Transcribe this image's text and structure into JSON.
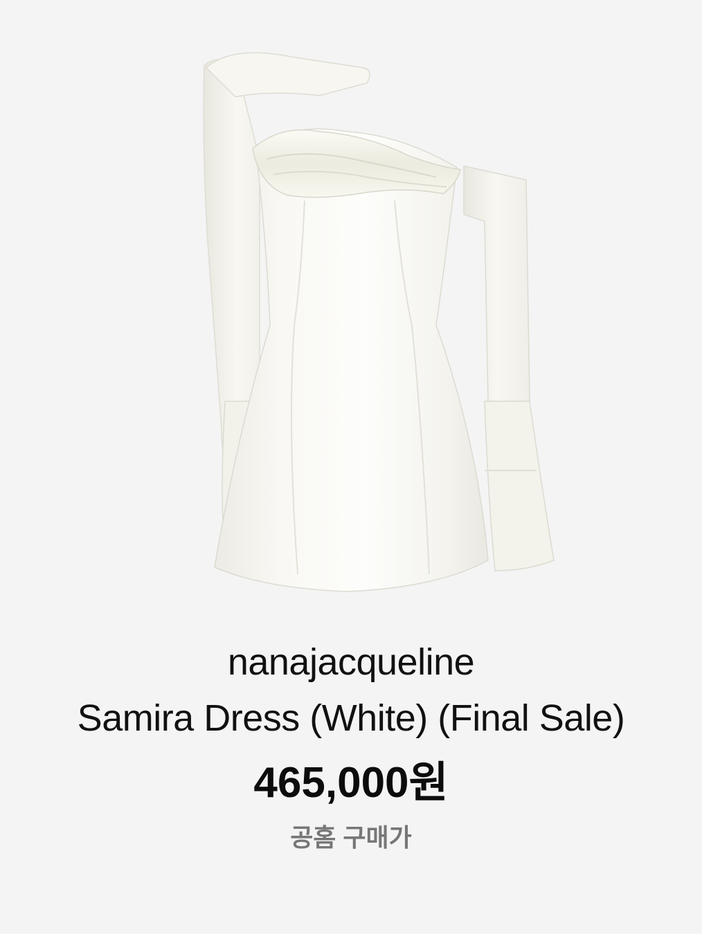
{
  "product": {
    "image_alt": "White one-shoulder long-sleeve mini dress",
    "brand": "nanajacqueline",
    "name": "Samira Dress (White) (Final Sale)",
    "price": "465,000원",
    "price_label": "공홈 구매가"
  },
  "colors": {
    "background": "#f4f4f4",
    "text_primary": "#111111",
    "text_secondary": "#777777",
    "dress_fabric": "#f7f6f1"
  }
}
